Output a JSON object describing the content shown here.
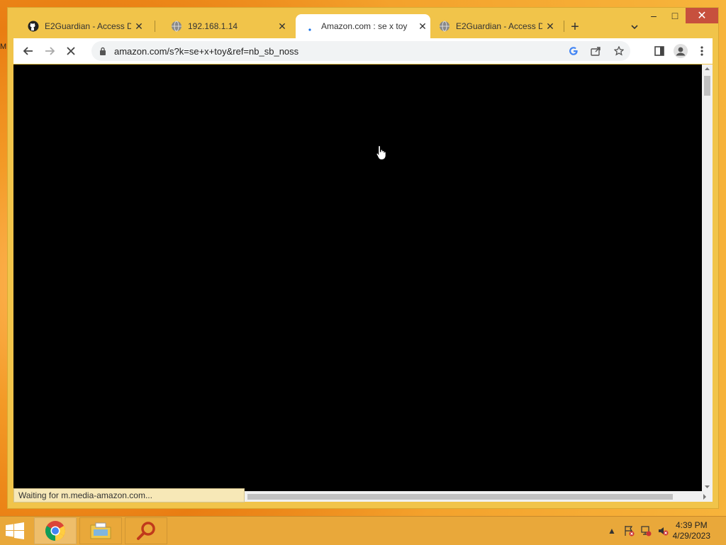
{
  "desktop": {
    "edge_label": "M"
  },
  "browser": {
    "tabs": [
      {
        "title": "E2Guardian - Access De",
        "icon": "github-icon",
        "active": false
      },
      {
        "title": "192.168.1.14",
        "icon": "globe-icon",
        "active": false
      },
      {
        "title": "Amazon.com : se x toy",
        "icon": "loading-icon",
        "active": true
      },
      {
        "title": "E2Guardian - Access De",
        "icon": "globe-icon",
        "active": false
      }
    ],
    "url": "amazon.com/s?k=se+x+toy&ref=nb_sb_noss",
    "status": "Waiting for m.media-amazon.com..."
  },
  "taskbar": {
    "time": "4:39 PM",
    "date": "4/29/2023"
  },
  "colors": {
    "window_frame": "#f1c44a",
    "close_button": "#c7503d",
    "taskbar": "#e9a83a"
  }
}
